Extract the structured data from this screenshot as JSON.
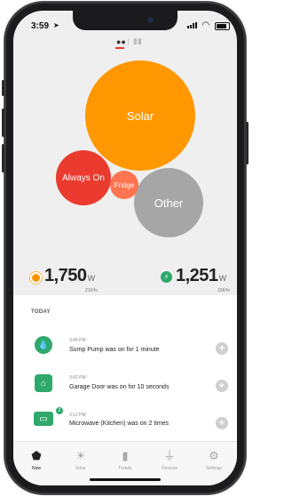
{
  "status_bar": {
    "time": "3:59"
  },
  "bubbles": {
    "solar": "Solar",
    "always_on": "Always On",
    "fridge": "Fridge",
    "other": "Other"
  },
  "solar_stat": {
    "value": "1,750",
    "unit": "W",
    "sub": "21¢/hr"
  },
  "usage_stat": {
    "value": "1,251",
    "unit": "W",
    "sub": "15¢/hr"
  },
  "feed": {
    "header": "TODAY",
    "items": [
      {
        "time": "3:46 PM",
        "message": "Sump Pump was on for 1 minute",
        "icon": "water-drop-icon"
      },
      {
        "time": "3:42 PM",
        "message": "Garage Door was on for 10 seconds",
        "icon": "garage-icon"
      },
      {
        "time": "3:12 PM",
        "message": "Microwave (Kitchen) was on 2 times",
        "icon": "microwave-icon",
        "badge": "2"
      }
    ]
  },
  "tabs": [
    {
      "label": "Now",
      "icon": "house-icon",
      "active": true
    },
    {
      "label": "Solar",
      "icon": "sun-icon",
      "active": false
    },
    {
      "label": "Trends",
      "icon": "bar-chart-icon",
      "active": false
    },
    {
      "label": "Devices",
      "icon": "plug-icon",
      "active": false
    },
    {
      "label": "Settings",
      "icon": "gear-icon",
      "active": false
    }
  ],
  "colors": {
    "solar": "#ff9800",
    "always_on": "#ea3b2e",
    "fridge": "#ff7451",
    "other": "#a6a6a6",
    "accent_green": "#2ea86b"
  }
}
